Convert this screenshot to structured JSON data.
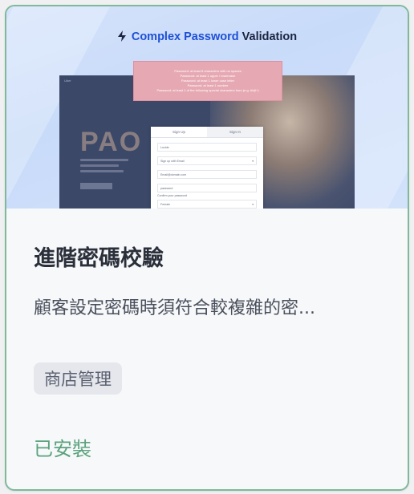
{
  "hero": {
    "title_prefix": "Complex Password",
    "title_suffix": "Validation",
    "password_rules": [
      "Password: at least 8 characters with no spaces",
      "Password: at least 1 upper / lowercase",
      "Password: at least 1 lower case letter",
      "Password: at least 1 number",
      "Password: at least 1 of the following special characters from (e.g. #!@^)"
    ],
    "mockup": {
      "top_left_text": "Uber",
      "brand_text": "PAO",
      "tabs": [
        "Sign Up",
        "Sign In"
      ],
      "fields": [
        "Lucide",
        "Sign up with Email",
        "Email@domain.com",
        "password"
      ],
      "confirm_label": "Confirm your password",
      "select_value": "Female"
    }
  },
  "card": {
    "title": "進階密碼校驗",
    "description": "顧客設定密碼時須符合較複雜的密...",
    "category_tag": "商店管理",
    "status": "已安裝"
  },
  "colors": {
    "border": "#7fb99a",
    "status": "#5aa27c",
    "accent": "#1e4fd6",
    "banner": "#e6a9b3"
  }
}
